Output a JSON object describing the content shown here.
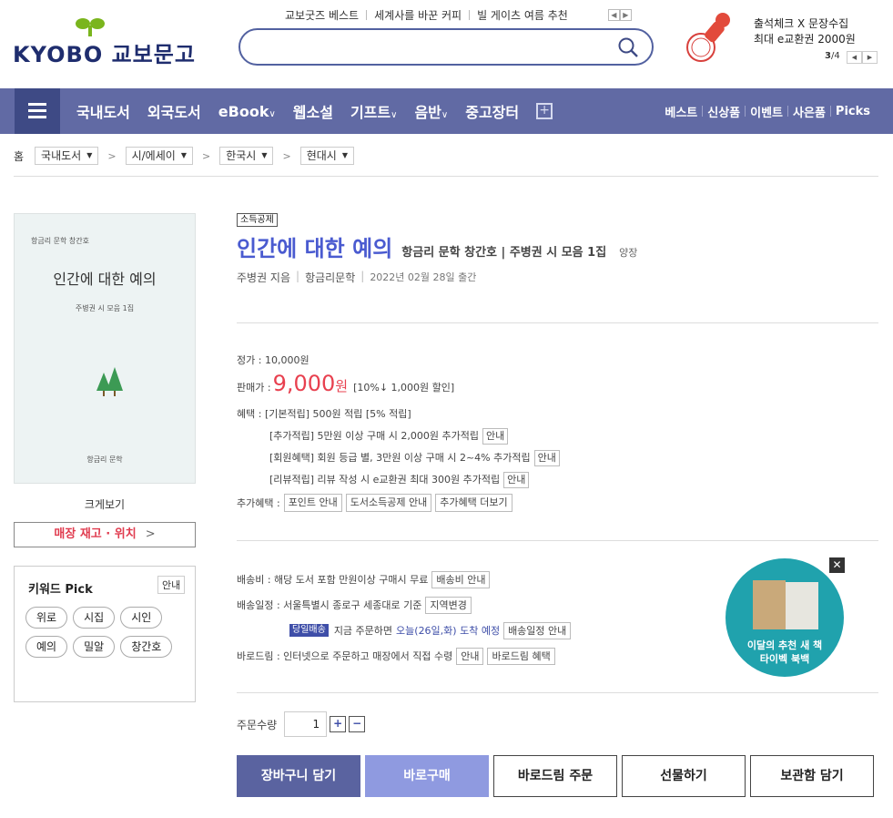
{
  "header": {
    "logo_text": "KYOBO 교보문고",
    "top_links": [
      "교보굿즈 베스트",
      "세계사를 바꾼 커피",
      "빌 게이츠 여름 추천"
    ],
    "search": {
      "placeholder": ""
    },
    "promo": {
      "line1": "출석체크 X 문장수집",
      "line2": "최대 e교환권 2000원",
      "page_current": "3",
      "page_total": "/4"
    }
  },
  "nav": {
    "items": [
      "국내도서",
      "외국도서",
      "eBook",
      "웹소설",
      "기프트",
      "음반",
      "중고장터"
    ],
    "right_links": [
      "베스트",
      "신상품",
      "이벤트",
      "사은품",
      "Picks"
    ]
  },
  "breadcrumb": {
    "home": "홈",
    "levels": [
      "국내도서",
      "시/에세이",
      "한국시",
      "현대시"
    ]
  },
  "cover": {
    "top": "항금리 문학 창간호",
    "title": "인간에 대한 예의",
    "subtitle": "주병권 시 모음 1집",
    "publisher": "항금리 문학"
  },
  "left": {
    "zoom_label": "크게보기",
    "stock_button": "매장 재고 · 위치",
    "keyword": {
      "title": "키워드 Pick",
      "guide": "안내",
      "tags": [
        "위로",
        "시집",
        "시인",
        "예의",
        "밀알",
        "창간호"
      ]
    }
  },
  "book": {
    "badge": "소득공제",
    "title": "인간에 대한 예의",
    "subtitle": "항금리 문학 창간호 | 주병권 시 모음 1집",
    "binding": "양장",
    "author": "주병권 지음",
    "publisher": "항금리문학",
    "date": "2022년 02월 28일 출간"
  },
  "price": {
    "list_label": "정가 :",
    "list_value": "10,000원",
    "sale_label": "판매가 :",
    "sale_value": "9,000",
    "sale_unit": "원",
    "discount": "[10%↓ 1,000원 할인]",
    "benefit_label": "혜택 :",
    "benefits": [
      "[기본적립] 500원 적립 [5% 적립]",
      "[추가적립] 5만원 이상 구매 시 2,000원 추가적립",
      "[회원혜택] 회원 등급 별, 3만원 이상 구매 시 2~4% 추가적립",
      "[리뷰적립] 리뷰 작성 시 e교환권 최대 300원 추가적립"
    ],
    "guide_btn": "안내",
    "extra_label": "추가혜택 :",
    "extra_buttons": [
      "포인트 안내",
      "도서소득공제 안내",
      "추가혜택 더보기"
    ]
  },
  "shipping": {
    "fee_text": "배송비 : 해당 도서 포함 만원이상 구매시 무료",
    "fee_btn": "배송비 안내",
    "schedule_text": "배송일정 : 서울특별시 종로구 세종대로 기준",
    "region_btn": "지역변경",
    "today_badge": "당일배송",
    "today_text": "지금 주문하면",
    "today_blue": "오늘(26일,화) 도착 예정",
    "schedule_btn": "배송일정 안내",
    "baro_text": "바로드림 : 인터넷으로 주문하고 매장에서 직접 수령",
    "baro_btn1": "안내",
    "baro_btn2": "바로드림 혜택"
  },
  "ad": {
    "line1": "이달의 추천 새 책",
    "line2": "타이벡 북백"
  },
  "order": {
    "qty_label": "주문수량",
    "qty_value": "1",
    "buttons": [
      "장바구니 담기",
      "바로구매",
      "바로드림 주문",
      "선물하기",
      "보관함 담기"
    ]
  }
}
